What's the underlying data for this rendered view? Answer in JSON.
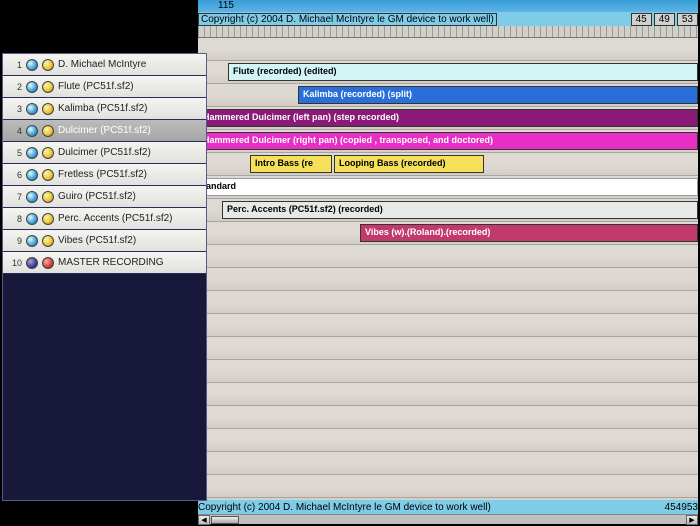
{
  "tempo_bar": {
    "value": "115"
  },
  "marker": {
    "text": "Copyright (c) 2004 D. Michael McIntyre le GM device to work well)",
    "nums": [
      "45",
      "49",
      "53"
    ]
  },
  "tracks": [
    {
      "num": "1",
      "name": "D. Michael McIntyre",
      "orb2": "yellow"
    },
    {
      "num": "2",
      "name": "Flute (PC51f.sf2)",
      "orb2": "yellow"
    },
    {
      "num": "3",
      "name": "Kalimba (PC51f.sf2)",
      "orb2": "yellow"
    },
    {
      "num": "4",
      "name": "Dulcimer (PC51f.sf2)",
      "orb2": "yellow",
      "selected": true
    },
    {
      "num": "5",
      "name": "Dulcimer (PC51f.sf2)",
      "orb2": "yellow"
    },
    {
      "num": "6",
      "name": "Fretless (PC51f.sf2)",
      "orb2": "yellow"
    },
    {
      "num": "7",
      "name": "Guiro (PC51f.sf2)",
      "orb2": "yellow"
    },
    {
      "num": "8",
      "name": "Perc. Accents (PC51f.sf2)",
      "orb2": "yellow"
    },
    {
      "num": "9",
      "name": "Vibes (PC51f.sf2)",
      "orb2": "yellow"
    },
    {
      "num": "10",
      "name": "MASTER RECORDING",
      "orb2": "red",
      "orb1": "darkblue"
    }
  ],
  "segments": {
    "flute": "Flute (recorded) (edited)",
    "kalimba": "Kalimba (recorded) (split)",
    "dulc_left": "Hammered Dulcimer (left pan) (step recorded)",
    "dulc_right": "Hammered Dulcimer (right pan) (copied , transposed, and doctored)",
    "intro_bass": "Intro Bass (re",
    "looping_bass": "Looping Bass (recorded)",
    "standard": "tandard",
    "perc": "Perc. Accents (PC51f.sf2) (recorded)",
    "vibes": "Vibes (w).(Roland).(recorded)"
  },
  "scroll": {
    "left": "◀",
    "right": "▶"
  }
}
